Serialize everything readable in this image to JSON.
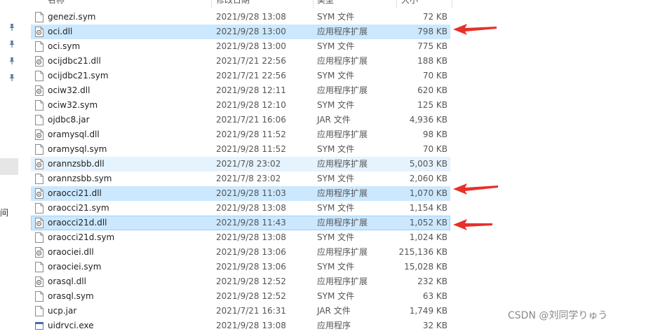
{
  "header": {
    "name": "名称",
    "date": "修改日期",
    "type": "类型",
    "size": "大小"
  },
  "files": [
    {
      "name": "genezi.sym",
      "date": "2021/9/28 13:08",
      "type": "SYM 文件",
      "size": "72 KB",
      "icon": "file-icon",
      "state": ""
    },
    {
      "name": "oci.dll",
      "date": "2021/9/28 13:00",
      "type": "应用程序扩展",
      "size": "798 KB",
      "icon": "dll-gear-icon",
      "state": "selected"
    },
    {
      "name": "oci.sym",
      "date": "2021/9/28 13:00",
      "type": "SYM 文件",
      "size": "775 KB",
      "icon": "file-icon",
      "state": ""
    },
    {
      "name": "ocijdbc21.dll",
      "date": "2021/7/21 22:56",
      "type": "应用程序扩展",
      "size": "188 KB",
      "icon": "dll-gear-icon",
      "state": ""
    },
    {
      "name": "ocijdbc21.sym",
      "date": "2021/7/21 22:56",
      "type": "SYM 文件",
      "size": "70 KB",
      "icon": "file-icon",
      "state": ""
    },
    {
      "name": "ociw32.dll",
      "date": "2021/9/28 12:11",
      "type": "应用程序扩展",
      "size": "620 KB",
      "icon": "dll-gear-icon",
      "state": ""
    },
    {
      "name": "ociw32.sym",
      "date": "2021/9/28 12:10",
      "type": "SYM 文件",
      "size": "125 KB",
      "icon": "file-icon",
      "state": ""
    },
    {
      "name": "ojdbc8.jar",
      "date": "2021/7/21 16:06",
      "type": "JAR 文件",
      "size": "4,936 KB",
      "icon": "file-icon",
      "state": ""
    },
    {
      "name": "oramysql.dll",
      "date": "2021/9/28 11:52",
      "type": "应用程序扩展",
      "size": "98 KB",
      "icon": "dll-gear-icon",
      "state": ""
    },
    {
      "name": "oramysql.sym",
      "date": "2021/9/28 11:52",
      "type": "SYM 文件",
      "size": "70 KB",
      "icon": "file-icon",
      "state": ""
    },
    {
      "name": "orannzsbb.dll",
      "date": "2021/7/8 23:02",
      "type": "应用程序扩展",
      "size": "5,003 KB",
      "icon": "dll-gear-icon",
      "state": "hover"
    },
    {
      "name": "orannzsbb.sym",
      "date": "2021/7/8 23:02",
      "type": "SYM 文件",
      "size": "2,060 KB",
      "icon": "file-icon",
      "state": ""
    },
    {
      "name": "oraocci21.dll",
      "date": "2021/9/28 11:03",
      "type": "应用程序扩展",
      "size": "1,070 KB",
      "icon": "dll-gear-icon",
      "state": "selected"
    },
    {
      "name": "oraocci21.sym",
      "date": "2021/9/28 13:08",
      "type": "SYM 文件",
      "size": "1,154 KB",
      "icon": "file-icon",
      "state": ""
    },
    {
      "name": "oraocci21d.dll",
      "date": "2021/9/28 11:43",
      "type": "应用程序扩展",
      "size": "1,052 KB",
      "icon": "dll-gear-icon",
      "state": "focused"
    },
    {
      "name": "oraocci21d.sym",
      "date": "2021/9/28 13:08",
      "type": "SYM 文件",
      "size": "1,024 KB",
      "icon": "file-icon",
      "state": ""
    },
    {
      "name": "oraociei.dll",
      "date": "2021/9/28 13:06",
      "type": "应用程序扩展",
      "size": "215,136 KB",
      "icon": "dll-gear-icon",
      "state": ""
    },
    {
      "name": "oraociei.sym",
      "date": "2021/9/28 13:06",
      "type": "SYM 文件",
      "size": "15,028 KB",
      "icon": "file-icon",
      "state": ""
    },
    {
      "name": "orasql.dll",
      "date": "2021/9/28 12:52",
      "type": "应用程序扩展",
      "size": "232 KB",
      "icon": "dll-gear-icon",
      "state": ""
    },
    {
      "name": "orasql.sym",
      "date": "2021/9/28 12:52",
      "type": "SYM 文件",
      "size": "63 KB",
      "icon": "file-icon",
      "state": ""
    },
    {
      "name": "ucp.jar",
      "date": "2021/7/21 16:31",
      "type": "JAR 文件",
      "size": "1,749 KB",
      "icon": "file-icon",
      "state": ""
    },
    {
      "name": "uidrvci.exe",
      "date": "2021/9/28 13:08",
      "type": "应用程序",
      "size": "32 KB",
      "icon": "exe-icon",
      "state": ""
    }
  ],
  "left_pane_text": "间",
  "annotation_color": "#e8302a",
  "watermark": "CSDN @刘同学りゅう"
}
